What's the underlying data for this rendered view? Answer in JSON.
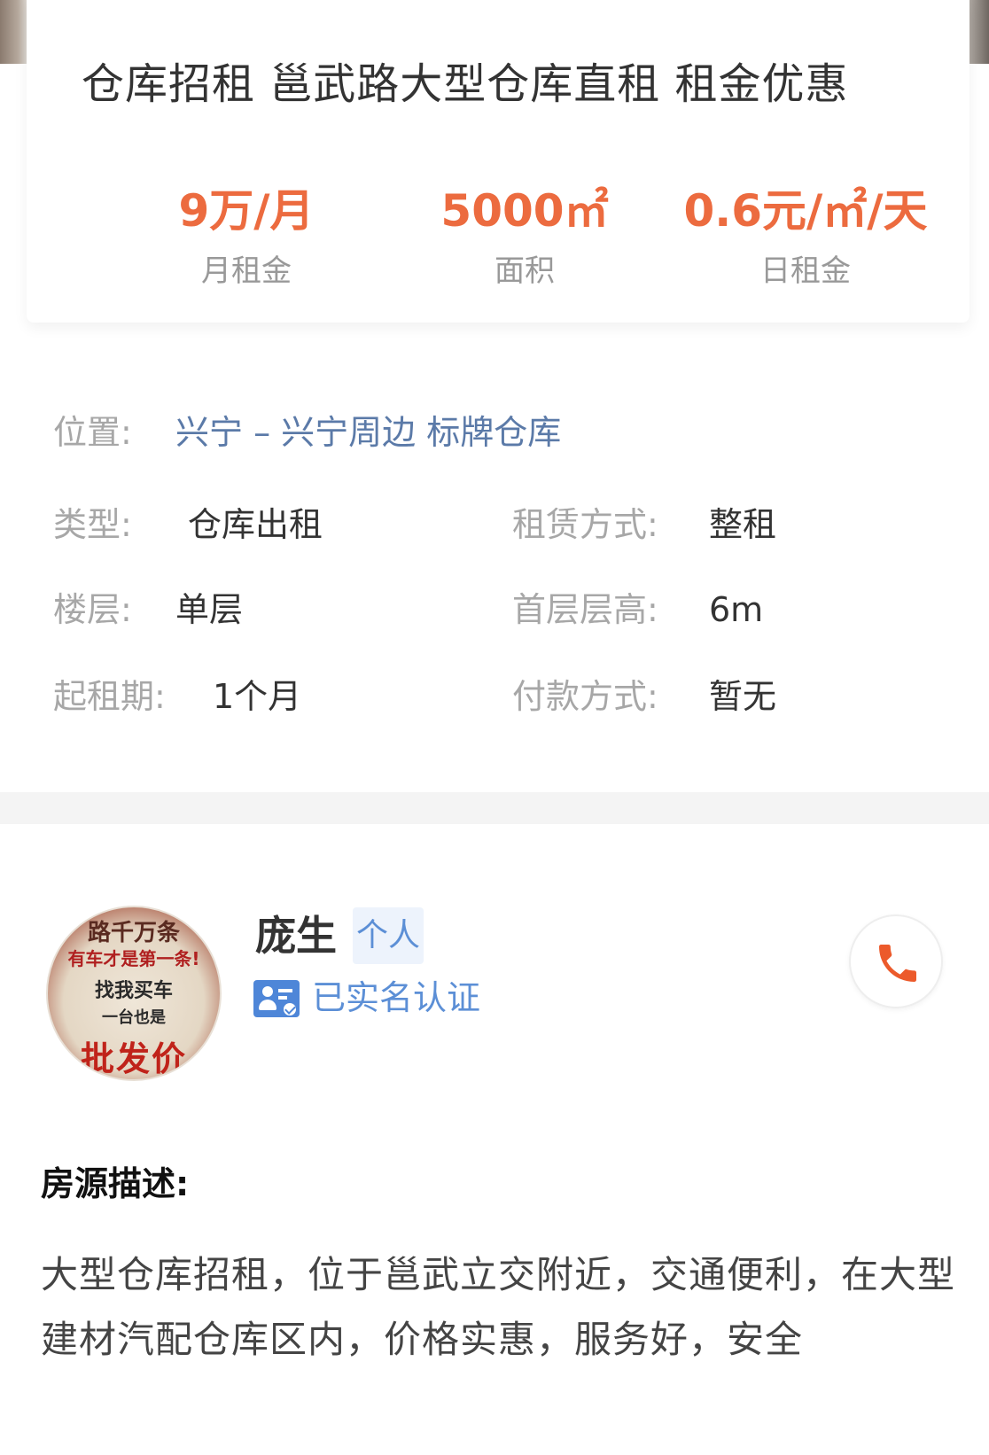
{
  "listing": {
    "title": "仓库招租 邕武路大型仓库直租 租金优惠",
    "stats": [
      {
        "value": "9万/月",
        "label": "月租金"
      },
      {
        "value": "5000㎡",
        "label": "面积"
      },
      {
        "value": "0.6元/㎡/天",
        "label": "日租金"
      }
    ]
  },
  "details": {
    "location": {
      "label": "位置:",
      "value": "兴宁 – 兴宁周边 标牌仓库"
    },
    "type": {
      "label": "类型:",
      "value": "仓库出租"
    },
    "lease_mode": {
      "label": "租赁方式:",
      "value": "整租"
    },
    "floor": {
      "label": "楼层:",
      "value": "单层"
    },
    "ground_height": {
      "label": "首层层高:",
      "value": "6m"
    },
    "min_term": {
      "label": "起租期:",
      "value": "1个月"
    },
    "payment": {
      "label": "付款方式:",
      "value": "暂无"
    }
  },
  "owner": {
    "name": "庞生",
    "tag": "个人",
    "verified_text": "已实名认证",
    "avatar_text": [
      "路千万条",
      "有车才是第一条!",
      "找我买车",
      "一台也是",
      "批发价"
    ]
  },
  "description": {
    "heading": "房源描述:",
    "body": "大型仓库招租，位于邕武立交附近，交通便利，在大型建材汽配仓库区内，价格实惠，服务好，安全"
  },
  "colors": {
    "accent": "#ec6b3f",
    "link": "#5b7aa8",
    "verify_blue": "#5c8fd6"
  },
  "icons": {
    "call": "phone-icon",
    "verified": "id-card-check-icon"
  }
}
